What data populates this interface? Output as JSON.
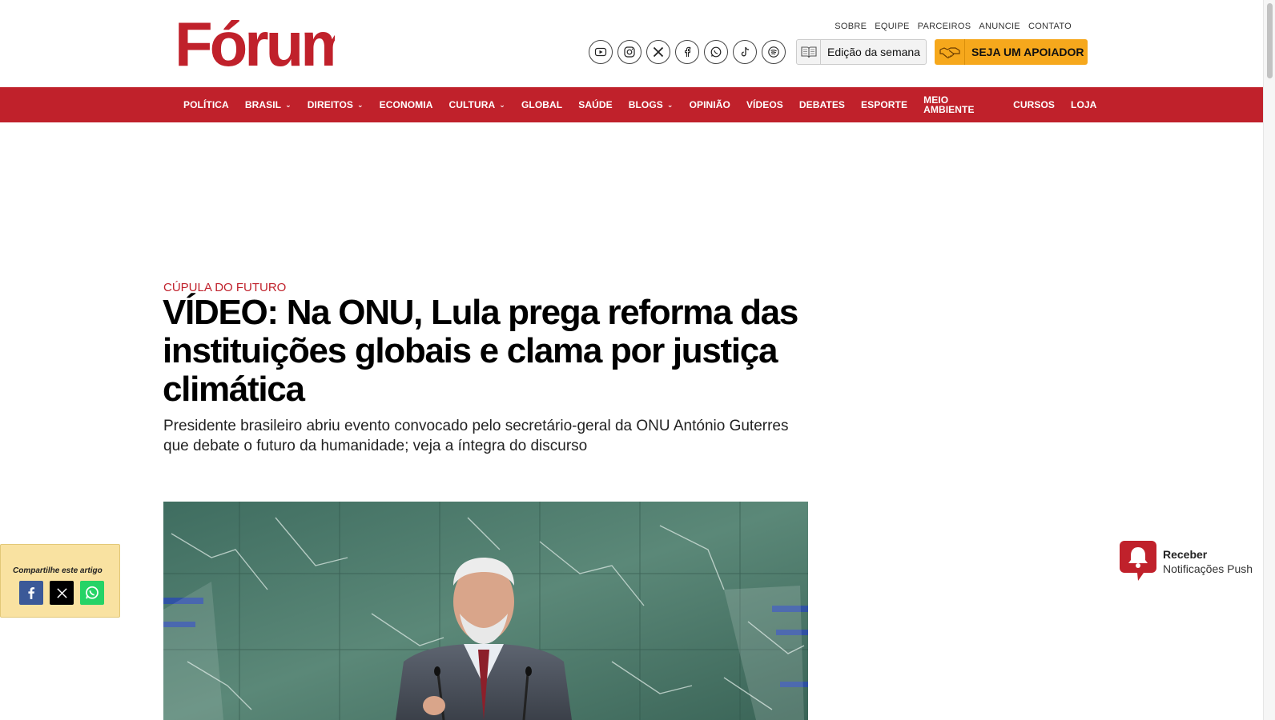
{
  "header": {
    "logo_text": "Fórum",
    "top_links": [
      "SOBRE",
      "EQUIPE",
      "PARCEIROS",
      "ANUNCIE",
      "CONTATO"
    ],
    "socials": [
      "youtube-icon",
      "instagram-icon",
      "x-icon",
      "facebook-icon",
      "whatsapp-icon",
      "tiktok-icon",
      "spotify-icon"
    ],
    "edicao_label": "Edição da semana",
    "apoiador_label": "SEJA UM APOIADOR"
  },
  "nav": {
    "items": [
      {
        "label": "POLÍTICA",
        "dropdown": false
      },
      {
        "label": "BRASIL",
        "dropdown": true
      },
      {
        "label": "DIREITOS",
        "dropdown": true
      },
      {
        "label": "ECONOMIA",
        "dropdown": false
      },
      {
        "label": "CULTURA",
        "dropdown": true
      },
      {
        "label": "GLOBAL",
        "dropdown": false
      },
      {
        "label": "SAÚDE",
        "dropdown": false
      },
      {
        "label": "BLOGS",
        "dropdown": true
      },
      {
        "label": "OPINIÃO",
        "dropdown": false
      },
      {
        "label": "VÍDEOS",
        "dropdown": false
      },
      {
        "label": "DEBATES",
        "dropdown": false
      },
      {
        "label": "ESPORTE",
        "dropdown": false
      },
      {
        "label": "MEIO AMBIENTE",
        "dropdown": false
      },
      {
        "label": "CURSOS",
        "dropdown": false
      },
      {
        "label": "LOJA",
        "dropdown": false
      }
    ]
  },
  "article": {
    "kicker": "CÚPULA DO FUTURO",
    "title": "VÍDEO: Na ONU, Lula prega reforma das instituições globais e clama por justiça climática",
    "subtitle": "Presidente brasileiro abriu evento convocado pelo secretário-geral da ONU António Guterres que debate o futuro da humanidade; veja a íntegra do discurso"
  },
  "share": {
    "label": "Compartilhe este artigo",
    "buttons": [
      "facebook-icon",
      "x-icon",
      "whatsapp-icon"
    ]
  },
  "push": {
    "title": "Receber",
    "subtitle": "Notificações Push"
  },
  "colors": {
    "brand_red": "#c0212b",
    "apoiador_orange": "#f6a81c",
    "share_bg": "#f9e2a1"
  }
}
